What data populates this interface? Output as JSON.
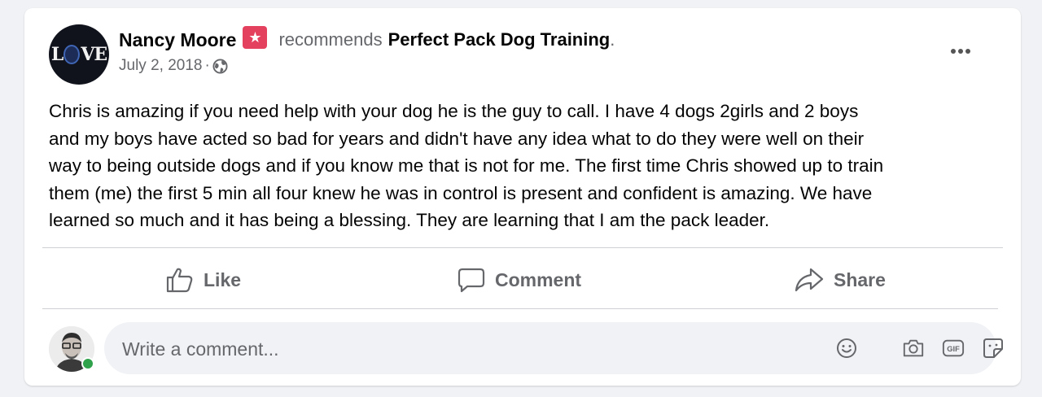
{
  "post": {
    "author": "Nancy Moore",
    "verb": "recommends",
    "page_name": "Perfect Pack Dog Training",
    "punct": ".",
    "date": "July 2, 2018",
    "date_sep": "·",
    "avatar_text": {
      "before": "L",
      "after": "VE"
    },
    "body_lines": [
      "Chris is amazing if you need help with your dog he is the guy to call.   I have 4 dogs 2girls and 2 boys",
      "and my boys have acted so bad for years and didn't have any idea what to do they were well on their",
      "way to being outside dogs and if you know me that is not for me. The first time Chris showed up to train",
      "them (me) the first 5 min all four knew he was in control is present and confident is amazing.  We have",
      "learned so much and it has being a blessing.  They are learning that I am the pack leader."
    ]
  },
  "actions": {
    "like": "Like",
    "comment": "Comment",
    "share": "Share"
  },
  "comment_box": {
    "placeholder": "Write a comment..."
  },
  "icons": {
    "badge": "recommendation-star-icon",
    "privacy": "globe-icon",
    "more": "more-options-icon",
    "like": "thumbs-up-icon",
    "comment": "speech-bubble-icon",
    "share": "share-arrow-icon",
    "emoji": "emoji-icon",
    "camera": "camera-icon",
    "gif": "gif-icon",
    "sticker": "sticker-icon"
  },
  "colors": {
    "badge": "#e4415f",
    "online": "#31a24c",
    "muted": "#65676b",
    "text": "#050505"
  }
}
